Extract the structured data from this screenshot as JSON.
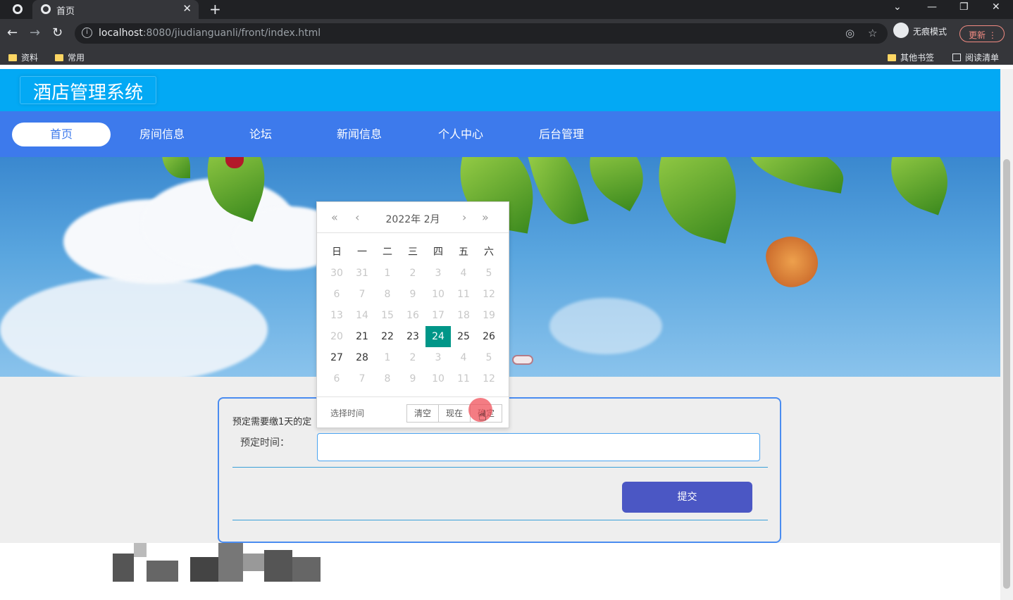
{
  "browser": {
    "tab_title": "首页",
    "tab_close": "✕",
    "new_tab": "+",
    "url_host": "localhost",
    "url_rest": ":8080/jiudianguanli/front/index.html",
    "incognito_label": "无痕模式",
    "update_label": "更新",
    "bookmarks": [
      "资料",
      "常用"
    ],
    "other_bookmarks": "其他书签",
    "reading_list": "阅读清单"
  },
  "site": {
    "title": "酒店管理系统",
    "nav": [
      "首页",
      "房间信息",
      "论坛",
      "新闻信息",
      "个人中心",
      "后台管理"
    ],
    "active_nav": "首页"
  },
  "form": {
    "note": "预定需要缴1天的定",
    "date_label": "预定时间：",
    "date_value": "",
    "submit_label": "提交"
  },
  "calendar": {
    "year_month": "2022年  2月",
    "weekdays": [
      "日",
      "一",
      "二",
      "三",
      "四",
      "五",
      "六"
    ],
    "days": [
      [
        [
          "30",
          "dis"
        ],
        [
          "31",
          "dis"
        ],
        [
          "1",
          "dis"
        ],
        [
          "2",
          "dis"
        ],
        [
          "3",
          "dis"
        ],
        [
          "4",
          "dis"
        ],
        [
          "5",
          "dis"
        ]
      ],
      [
        [
          "6",
          "dis"
        ],
        [
          "7",
          "dis"
        ],
        [
          "8",
          "dis"
        ],
        [
          "9",
          "dis"
        ],
        [
          "10",
          "dis"
        ],
        [
          "11",
          "dis"
        ],
        [
          "12",
          "dis"
        ]
      ],
      [
        [
          "13",
          "dis"
        ],
        [
          "14",
          "dis"
        ],
        [
          "15",
          "dis"
        ],
        [
          "16",
          "dis"
        ],
        [
          "17",
          "dis"
        ],
        [
          "18",
          "dis"
        ],
        [
          "19",
          "dis"
        ]
      ],
      [
        [
          "20",
          "dis"
        ],
        [
          "21",
          "cur"
        ],
        [
          "22",
          "cur"
        ],
        [
          "23",
          "cur"
        ],
        [
          "24",
          "sel"
        ],
        [
          "25",
          "cur"
        ],
        [
          "26",
          "cur"
        ]
      ],
      [
        [
          "27",
          "cur"
        ],
        [
          "28",
          "cur"
        ],
        [
          "1",
          "dis"
        ],
        [
          "2",
          "dis"
        ],
        [
          "3",
          "dis"
        ],
        [
          "4",
          "dis"
        ],
        [
          "5",
          "dis"
        ]
      ],
      [
        [
          "6",
          "dis"
        ],
        [
          "7",
          "dis"
        ],
        [
          "8",
          "dis"
        ],
        [
          "9",
          "dis"
        ],
        [
          "10",
          "dis"
        ],
        [
          "11",
          "dis"
        ],
        [
          "12",
          "dis"
        ]
      ]
    ],
    "footer_label": "选择时间",
    "clear_label": "清空",
    "now_label": "现在",
    "confirm_label": "确定"
  }
}
